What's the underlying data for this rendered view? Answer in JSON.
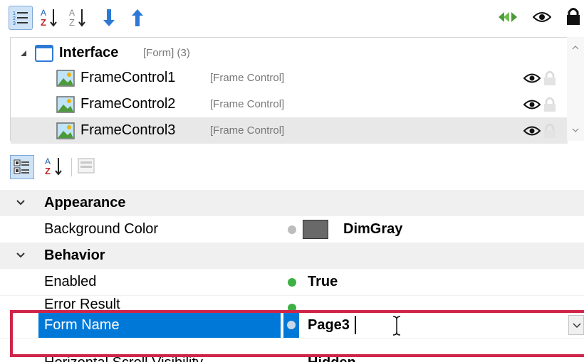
{
  "toolbar_top": {
    "buttons": [
      {
        "name": "categorized-view-icon"
      },
      {
        "name": "sort-az-icon"
      },
      {
        "name": "sort-az-alt-icon"
      },
      {
        "name": "move-down-icon"
      },
      {
        "name": "move-up-icon"
      }
    ],
    "right_icons": [
      "collapse-arrows-icon",
      "eye-icon",
      "lock-icon"
    ]
  },
  "tree": {
    "root": {
      "label": "Interface",
      "type": "[Form] (3)"
    },
    "children": [
      {
        "label": "FrameControl1",
        "type": "[Frame Control]"
      },
      {
        "label": "FrameControl2",
        "type": "[Frame Control]"
      },
      {
        "label": "FrameControl3",
        "type": "[Frame Control]"
      }
    ]
  },
  "property_grid": {
    "categories": [
      {
        "label": "Appearance",
        "properties": [
          {
            "label": "Background Color",
            "value": "DimGray",
            "swatch": "#696969"
          }
        ]
      },
      {
        "label": "Behavior",
        "properties": [
          {
            "label": "Enabled",
            "value": "True"
          },
          {
            "label": "Error Result",
            "value": ""
          },
          {
            "label": "Form Name",
            "value": "Page3"
          },
          {
            "label": "Horizontal Scroll Visibility",
            "value": "Hidden"
          }
        ]
      }
    ]
  },
  "colors": {
    "accent": "#0078d7",
    "highlight_border": "#d0254a",
    "green_dot": "#3cb043",
    "gray_dot": "#a0a0a0"
  }
}
